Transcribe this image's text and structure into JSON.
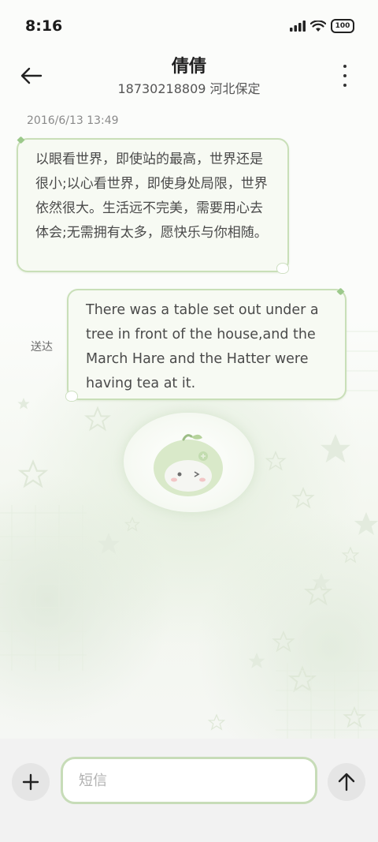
{
  "status_bar": {
    "time": "8:16",
    "battery": "100",
    "icons": [
      "signal-icon",
      "wifi-icon",
      "battery-icon"
    ]
  },
  "header": {
    "title": "倩倩",
    "subtitle": "18730218809 河北保定",
    "back_icon": "back-arrow-icon",
    "more_icon": "more-vertical-icon"
  },
  "conversation": {
    "timestamp": "2016/6/13 13:49",
    "messages": [
      {
        "direction": "incoming",
        "text": "以眼看世界，即使站的最高，世界还是很小;以心看世界，即使身处局限，世界依然很大。生活远不完美，需要用心去体会;无需拥有太多，愿快乐与你相随。"
      },
      {
        "direction": "outgoing",
        "text": "There was a table set out under a tree in front of the house,and the March Hare and the Hatter were having tea at it.",
        "status": "送达"
      }
    ]
  },
  "composer": {
    "placeholder": "短信",
    "add_icon": "plus-icon",
    "send_icon": "arrow-up-icon"
  },
  "colors": {
    "bubble_border": "#c9dfb8",
    "bubble_fill": "#f7faf3",
    "input_border": "#c7dcb8",
    "bar_bg": "#f2f2f2"
  }
}
